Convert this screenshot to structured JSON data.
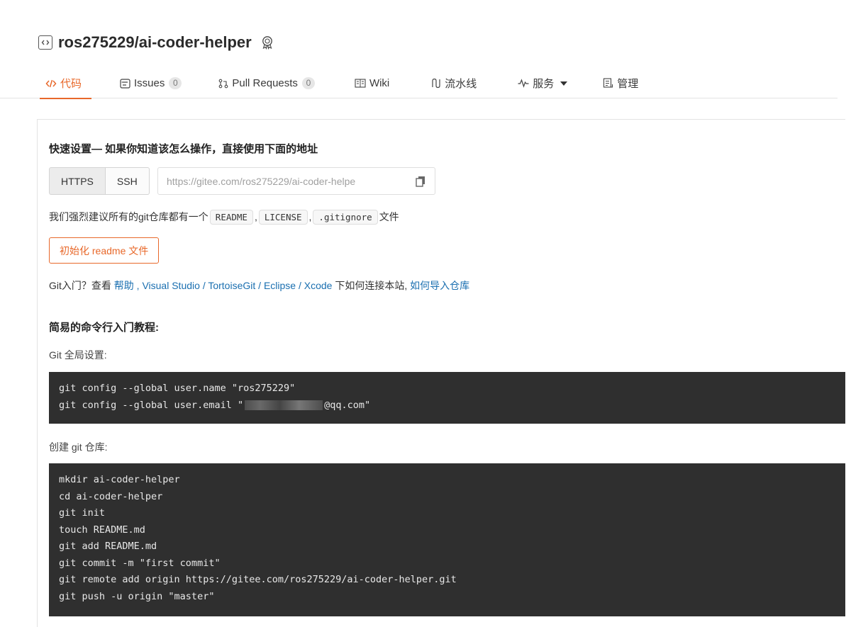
{
  "repo": {
    "title": "ros275229/ai-coder-helper"
  },
  "tabs": [
    {
      "label": "代码",
      "active": true
    },
    {
      "label": "Issues",
      "count": "0"
    },
    {
      "label": "Pull Requests",
      "count": "0"
    },
    {
      "label": "Wiki"
    },
    {
      "label": "流水线"
    },
    {
      "label": "服务"
    },
    {
      "label": "管理"
    }
  ],
  "quick_setup": {
    "title": "快速设置— 如果你知道该怎么操作，直接使用下面的地址",
    "protocols": [
      "HTTPS",
      "SSH"
    ],
    "selected_protocol": "HTTPS",
    "url": "https://gitee.com/ros275229/ai-coder-helpe",
    "suggest_prefix": "我们强烈建议所有的git仓库都有一个",
    "suggest_files": [
      "README",
      "LICENSE",
      ".gitignore"
    ],
    "suggest_sep": ",",
    "suggest_suffix": "文件",
    "init_button": "初始化 readme 文件"
  },
  "guide": {
    "prefix": "Git入门？查看",
    "help": "帮助",
    "sep1": ",",
    "vs": "Visual Studio",
    "slash": "/",
    "tortoise": "TortoiseGit",
    "eclipse": "Eclipse",
    "xcode": "Xcode",
    "middle": "下如何连接本站,",
    "import": "如何导入仓库"
  },
  "tutorial": {
    "title": "简易的命令行入门教程:",
    "global_label": "Git 全局设置:",
    "global_cmds": [
      "git config --global user.name \"ros275229\"",
      "git config --global user.email \""
    ],
    "email_suffix": "@qq.com\"",
    "create_label": "创建 git 仓库:",
    "create_cmds": [
      "mkdir ai-coder-helper",
      "cd ai-coder-helper",
      "git init",
      "touch README.md",
      "git add README.md",
      "git commit -m \"first commit\"",
      "git remote add origin https://gitee.com/ros275229/ai-coder-helper.git",
      "git push -u origin \"master\""
    ]
  },
  "colors": {
    "accent": "#e8682a",
    "link": "#1a6fb0",
    "code_bg": "#2f2f2f"
  }
}
